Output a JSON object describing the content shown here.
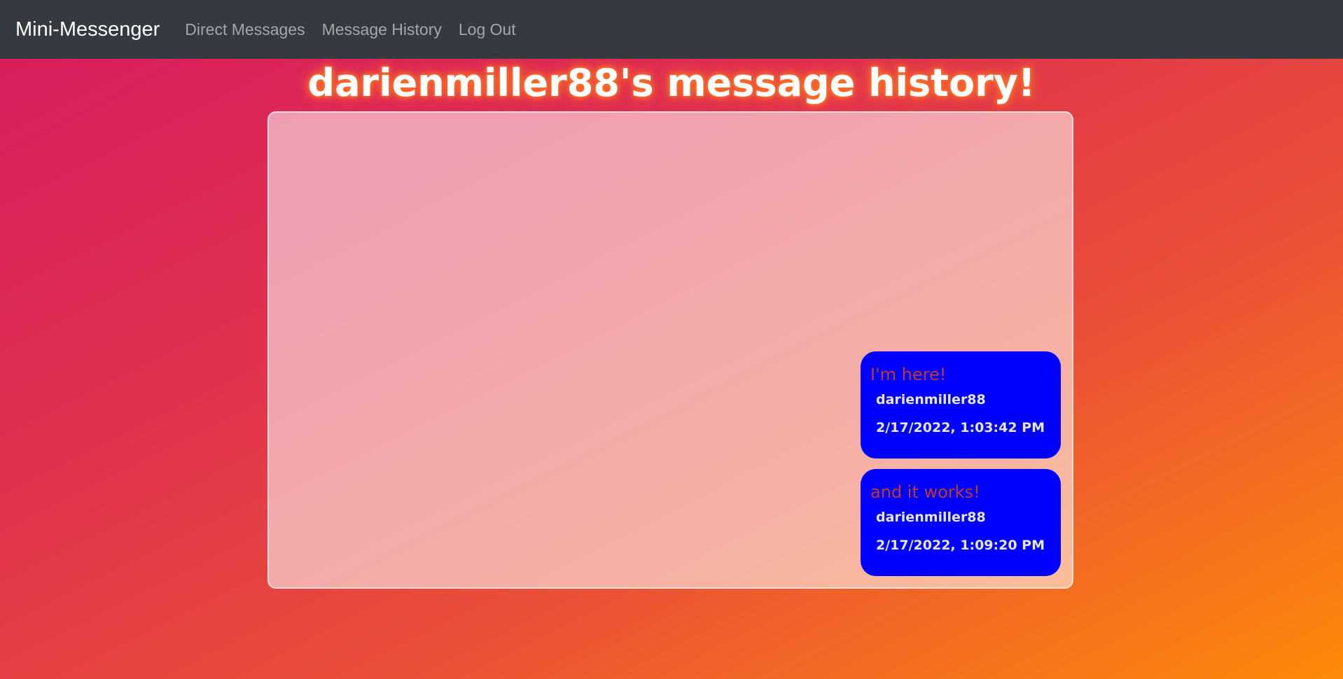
{
  "navbar": {
    "brand": "Mini-Messenger",
    "links": [
      "Direct Messages",
      "Message History",
      "Log Out"
    ],
    "background": "#343a40"
  },
  "page": {
    "title": "darienmiller88's message history!"
  },
  "messages": [
    {
      "text": "I'm here!",
      "sender": "darienmiller88",
      "timestamp": "2/17/2022, 1:03:42 PM"
    },
    {
      "text": "and it works!",
      "sender": "darienmiller88",
      "timestamp": "2/17/2022, 1:09:20 PM"
    }
  ],
  "colors": {
    "bubble": "#0000ff",
    "message_text": "#c0392b",
    "gradient_start": "#d81b60",
    "gradient_end": "#fe8908"
  }
}
